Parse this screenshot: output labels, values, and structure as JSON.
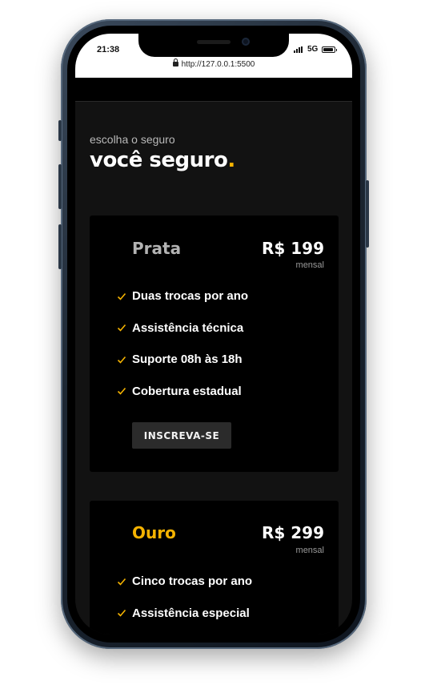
{
  "status": {
    "time": "21:38",
    "network": "5G",
    "battery_level": 0.9
  },
  "browser": {
    "url": "http://127.0.0.1:5500"
  },
  "hero": {
    "subtitle": "escolha o seguro",
    "title": "você seguro",
    "title_dot": "."
  },
  "plans": [
    {
      "name": "Prata",
      "name_color": "#b3b3b3",
      "price": "R$ 199",
      "period": "mensal",
      "features": [
        "Duas trocas por ano",
        "Assistência técnica",
        "Suporte 08h às 18h",
        "Cobertura estadual"
      ],
      "button_label": "INSCREVA-SE"
    },
    {
      "name": "Ouro",
      "name_color": "#f5b301",
      "price": "R$ 299",
      "period": "mensal",
      "features": [
        "Cinco trocas por ano",
        "Assistência especial"
      ]
    }
  ],
  "colors": {
    "accent": "#f5b301",
    "background": "#121212",
    "card": "#000000"
  },
  "icons": {
    "feature_bullet": "check-icon",
    "secure": "lock-icon"
  }
}
